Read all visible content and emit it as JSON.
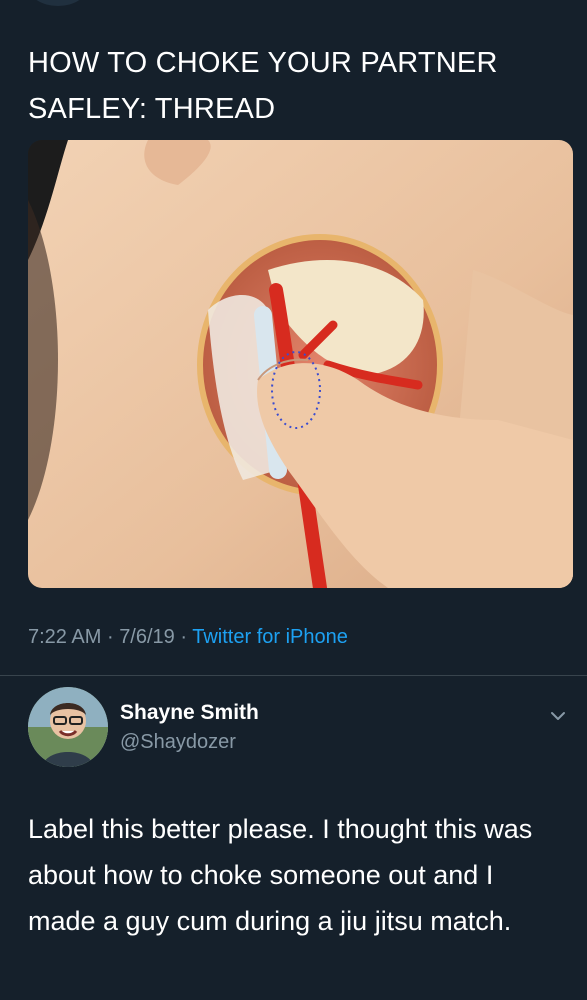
{
  "tweet": {
    "text": "HOW TO CHOKE YOUR PARTNER SAFLEY: THREAD",
    "media_icon": "anatomical-neck-illustration",
    "time": "7:22 AM",
    "separator": "·",
    "date": "7/6/19",
    "source": "Twitter for iPhone"
  },
  "reply": {
    "avatar_icon": "user-avatar",
    "name": "Shayne Smith",
    "handle": "@Shaydozer",
    "menu_icon": "chevron-down-icon",
    "text": "Label this better please. I thought this was about how to choke someone out and I made a guy cum during a jiu jitsu match."
  },
  "colors": {
    "background": "#15202b",
    "secondary_text": "#8899a6",
    "link": "#1da1f2",
    "divider": "#38444d"
  }
}
